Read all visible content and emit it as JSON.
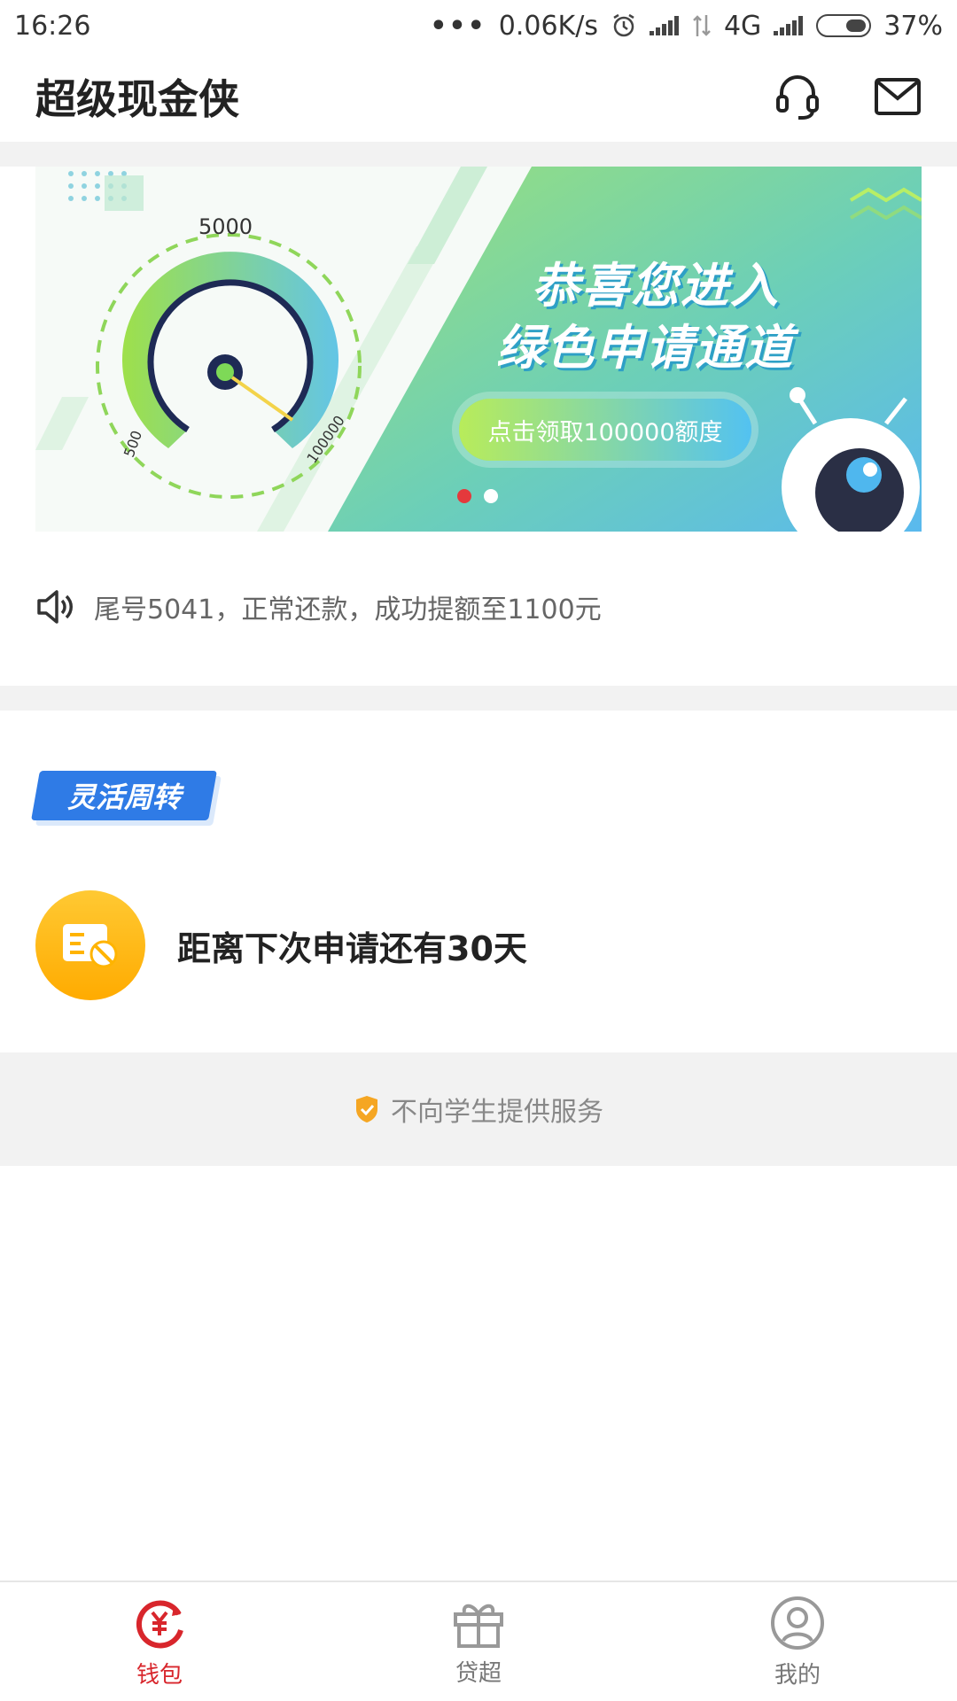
{
  "status_bar": {
    "time": "16:26",
    "dots": "•••",
    "net_speed": "0.06K/s",
    "network": "4G",
    "battery": "37%"
  },
  "header": {
    "title": "超级现金侠",
    "icons": [
      "headset-icon",
      "mail-icon"
    ]
  },
  "banner": {
    "gauge_top": "5000",
    "gauge_left": "500",
    "gauge_right": "100000",
    "line1": "恭喜您进入",
    "line2": "绿色申请通道",
    "cta": "点击领取100000额度",
    "active_dot_color": "#e4393c"
  },
  "notice": {
    "text": "尾号5041，正常还款，成功提额至1100元"
  },
  "section": {
    "tag": "灵活周转",
    "apply_message": "距离下次申请还有30天"
  },
  "footer": {
    "text": "不向学生提供服务"
  },
  "nav": {
    "items": [
      {
        "label": "钱包",
        "icon": "wallet-yen-icon",
        "active": true
      },
      {
        "label": "贷超",
        "icon": "gift-icon",
        "active": false
      },
      {
        "label": "我的",
        "icon": "user-icon",
        "active": false
      }
    ]
  },
  "colors": {
    "accent": "#d8262c",
    "tag_blue": "#2f7be6",
    "orange": "#ffab00"
  }
}
